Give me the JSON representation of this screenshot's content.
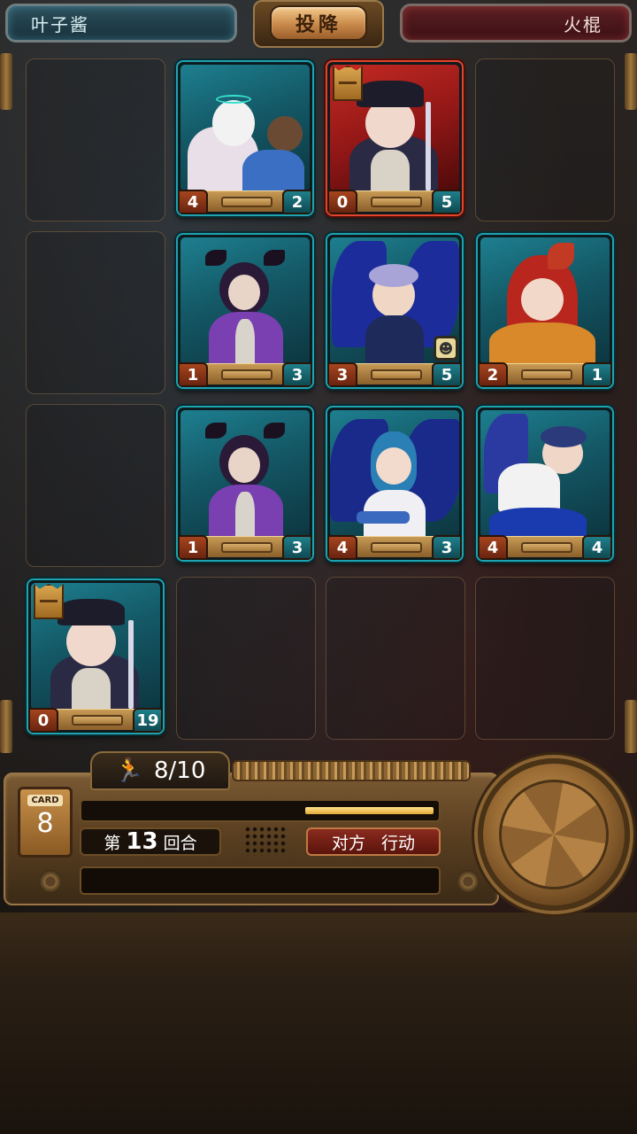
{
  "top": {
    "player_name": "叶子酱",
    "surrender_label": "投降",
    "opponent_name": "火棍"
  },
  "board": {
    "cards": [
      {
        "id": "r1c2",
        "attack": "4",
        "health": "2",
        "frame": "teal",
        "character": "white-haired-with-bear"
      },
      {
        "id": "r1c3",
        "attack": "0",
        "health": "5",
        "frame": "red",
        "character": "pirate-captain-girl",
        "crown": true
      },
      {
        "id": "r2c2",
        "attack": "1",
        "health": "3",
        "frame": "teal",
        "character": "horned-demon"
      },
      {
        "id": "r2c3",
        "attack": "3",
        "health": "5",
        "frame": "teal",
        "character": "winged-sailor-boy",
        "mask": true
      },
      {
        "id": "r2c4",
        "attack": "2",
        "health": "1",
        "frame": "teal",
        "character": "red-fox-girl"
      },
      {
        "id": "r3c2",
        "attack": "1",
        "health": "3",
        "frame": "teal",
        "character": "horned-demon"
      },
      {
        "id": "r3c3",
        "attack": "4",
        "health": "3",
        "frame": "teal",
        "character": "winged-guitarist"
      },
      {
        "id": "r3c4",
        "attack": "4",
        "health": "4",
        "frame": "teal",
        "character": "blue-haired-runner"
      },
      {
        "id": "r4c1",
        "attack": "0",
        "health": "19",
        "frame": "teal",
        "character": "pirate-captain-girl",
        "crown": true
      }
    ]
  },
  "panel": {
    "moves_current": "8",
    "moves_max": "10",
    "moves_text": "8/10",
    "card_label": "CARD",
    "card_count": "8",
    "turn_prefix": "第",
    "turn_number": "13",
    "turn_suffix": "回合",
    "action_word1": "对方",
    "action_word2": "行动",
    "progress_fraction": 0.37
  },
  "colors": {
    "player_plate": "#17303a",
    "opponent_plate": "#3a1014",
    "card_frame_teal": "#1ea3b0",
    "card_frame_red": "#e0442e",
    "atk_badge": "#a5451e",
    "hp_badge": "#1f7f8a"
  }
}
